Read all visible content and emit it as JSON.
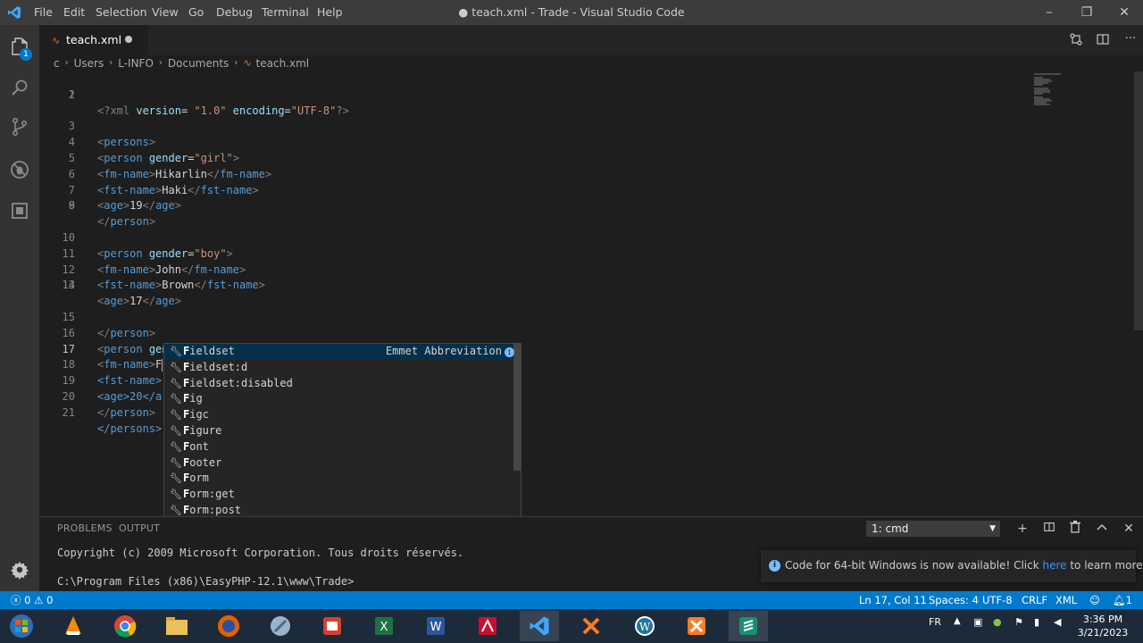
{
  "window": {
    "title": "● teach.xml - Trade - Visual Studio Code",
    "minimize": "–",
    "restore": "❐",
    "close": "✕"
  },
  "menu": [
    "File",
    "Edit",
    "Selection",
    "View",
    "Go",
    "Debug",
    "Terminal",
    "Help"
  ],
  "activity": {
    "explorer_badge": "1"
  },
  "tab": {
    "name": "teach.xml",
    "icon": "rss-icon"
  },
  "breadcrumb": [
    "c",
    "Users",
    "L-INFO",
    "Documents",
    "teach.xml"
  ],
  "editor": {
    "active_line": 17,
    "lines": [
      {
        "n": "1"
      },
      {
        "n": "2"
      },
      {
        "n": "3"
      },
      {
        "n": "4"
      },
      {
        "n": "5"
      },
      {
        "n": "6"
      },
      {
        "n": "7"
      },
      {
        "n": "8"
      },
      {
        "n": "9"
      },
      {
        "n": "10"
      },
      {
        "n": "11"
      },
      {
        "n": "12"
      },
      {
        "n": "13"
      },
      {
        "n": "14"
      },
      {
        "n": "15"
      },
      {
        "n": "16"
      },
      {
        "n": "17"
      },
      {
        "n": "18"
      },
      {
        "n": "19"
      },
      {
        "n": "20"
      },
      {
        "n": "21"
      }
    ],
    "text": {
      "l1_a": "<?xml ",
      "l1_b": "version",
      "l1_c": "= ",
      "l1_d": "\"1.0\"",
      "l1_e": " encoding",
      "l1_f": "=",
      "l1_g": "\"UTF-8\"",
      "l1_h": "?>",
      "persons_open": "persons",
      "person": "person",
      "gender": "gender",
      "girl": "\"girl\"",
      "boy": "\"boy\"",
      "fm_name": "fm-name",
      "fst_name": "fst-name",
      "age": "age",
      "v_hikarlin": "Hikarlin",
      "v_haki": "Haki",
      "v_19": "19",
      "v_john": "John",
      "v_brown": "Brown",
      "v_17": "17",
      "v_F": "F",
      "v_20": "20",
      "l18_tail": "<fst-name>",
      "l19_tail": "<age>20</a",
      "l21_tail": "</persons>"
    }
  },
  "suggest": {
    "detail": "Emmet Abbreviation",
    "items": [
      {
        "first": "F",
        "rest": "ieldset"
      },
      {
        "first": "F",
        "rest": "ieldset:d"
      },
      {
        "first": "F",
        "rest": "ieldset:disabled"
      },
      {
        "first": "F",
        "rest": "ig"
      },
      {
        "first": "F",
        "rest": "igc"
      },
      {
        "first": "F",
        "rest": "igure"
      },
      {
        "first": "F",
        "rest": "ont"
      },
      {
        "first": "F",
        "rest": "ooter"
      },
      {
        "first": "F",
        "rest": "orm"
      },
      {
        "first": "F",
        "rest": "orm:get"
      },
      {
        "first": "F",
        "rest": "orm:post"
      },
      {
        "first": "F",
        "rest": "rame"
      }
    ]
  },
  "panel": {
    "tabs": [
      "PROBLEMS",
      "OUTPUT"
    ],
    "terminal_select": "1: cmd",
    "terminal_lines": [
      "Copyright (c) 2009 Microsoft Corporation. Tous droits réservés.",
      "C:\\Program Files (x86)\\EasyPHP-12.1\\www\\Trade>"
    ]
  },
  "notification": {
    "before": "Code for 64-bit Windows is now available! Click ",
    "link": "here",
    "after": " to learn more."
  },
  "status": {
    "errors": "0",
    "warnings": "0",
    "position": "Ln 17, Col 11",
    "spaces": "Spaces: 4",
    "encoding": "UTF-8",
    "eol": "CRLF",
    "language": "XML",
    "notifications": "1"
  },
  "taskbar": {
    "lang": "FR",
    "time": "3:36 PM",
    "date": "3/21/2023",
    "apps": [
      "start-orb-icon",
      "vlc-icon",
      "chrome-icon",
      "file-explorer-icon",
      "firefox-icon",
      "tool-icon",
      "pdf-reader-icon",
      "excel-icon",
      "word-icon",
      "acrobat-icon",
      "vscode-icon",
      "xampp-icon",
      "wordpress-icon",
      "xampp-control-icon",
      "sublime-icon"
    ]
  },
  "colors": {
    "accent": "#007acc",
    "tag": "#569cd6",
    "attr": "#9cdcfe",
    "string": "#ce9178"
  }
}
